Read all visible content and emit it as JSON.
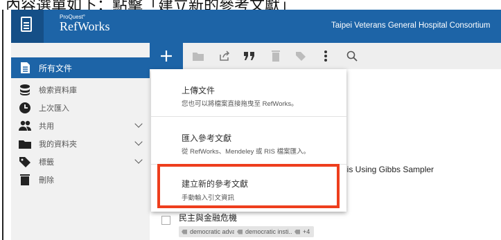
{
  "top_caption": "內容選單如下：點擊「建立新的參考文獻」",
  "header": {
    "brand_top": "ProQuest°",
    "brand_name": "RefWorks",
    "organization": "Taipei Veterans General Hospital Consortium"
  },
  "sidebar": {
    "items": [
      {
        "label": "所有文件",
        "active": true
      },
      {
        "label": "檢索資料庫"
      },
      {
        "label": "上次匯入"
      },
      {
        "label": "共用"
      },
      {
        "label": "我的資料夾"
      },
      {
        "label": "標籤"
      },
      {
        "label": "刪除"
      }
    ]
  },
  "toolbar": {
    "icons": [
      "plus-icon",
      "folder-icon",
      "share-icon",
      "quote-icon",
      "trash-icon",
      "tag-icon",
      "more-icon",
      "search-icon"
    ]
  },
  "menu": {
    "items": [
      {
        "title": "上傳文件",
        "desc": "您也可以將檔案直接拖曳至 RefWorks。"
      },
      {
        "title": "匯入參考文獻",
        "desc": "從 RefWorks、Mendeley 或 RIS 檔案匯入。"
      },
      {
        "title": "建立新的參考文獻",
        "desc": "手動輸入引文資訊"
      }
    ]
  },
  "list": {
    "partial_title": "risis Using Gibbs Sampler",
    "row2_title": "民主與金融危機",
    "tags": [
      "democratic adva...",
      "democratic insti...",
      "+4"
    ]
  },
  "colors": {
    "brand": "#1d64a7",
    "highlight": "#ee3e1d",
    "sidebar_bg": "#f1f1f1"
  }
}
